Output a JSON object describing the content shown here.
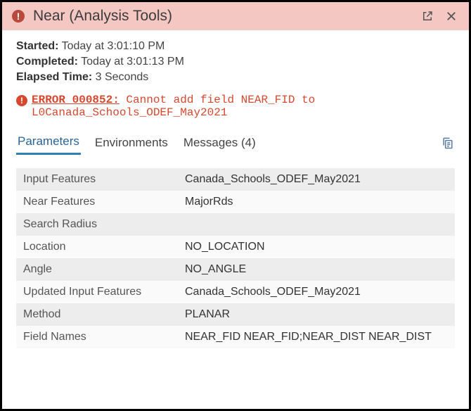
{
  "titlebar": {
    "title": "Near (Analysis Tools)"
  },
  "meta": {
    "started_label": "Started:",
    "started_value": "Today at 3:01:10 PM",
    "completed_label": "Completed:",
    "completed_value": "Today at 3:01:13 PM",
    "elapsed_label": "Elapsed Time:",
    "elapsed_value": "3 Seconds"
  },
  "error": {
    "code_link": "ERROR 000852:",
    "message_rest": " Cannot add field NEAR_FID to L0Canada_Schools_ODEF_May2021"
  },
  "tabs": {
    "parameters": "Parameters",
    "environments": "Environments",
    "messages": "Messages (4)"
  },
  "params": [
    {
      "label": "Input Features",
      "value": "Canada_Schools_ODEF_May2021"
    },
    {
      "label": "Near Features",
      "value": "MajorRds"
    },
    {
      "label": "Search Radius",
      "value": ""
    },
    {
      "label": "Location",
      "value": "NO_LOCATION"
    },
    {
      "label": "Angle",
      "value": "NO_ANGLE"
    },
    {
      "label": "Updated Input Features",
      "value": "Canada_Schools_ODEF_May2021"
    },
    {
      "label": "Method",
      "value": "PLANAR"
    },
    {
      "label": "Field Names",
      "value": "NEAR_FID NEAR_FID;NEAR_DIST NEAR_DIST"
    }
  ]
}
